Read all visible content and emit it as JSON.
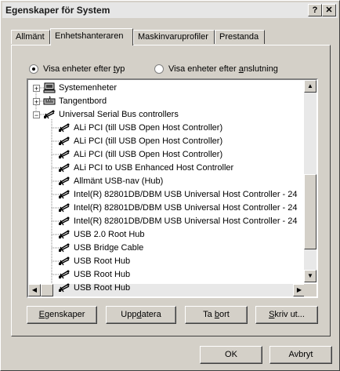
{
  "window": {
    "title": "Egenskaper för System",
    "help_label": "?",
    "close_label": "✕"
  },
  "tabs": [
    {
      "label": "Allmänt"
    },
    {
      "label": "Enhetshanteraren"
    },
    {
      "label": "Maskinvaruprofiler"
    },
    {
      "label": "Prestanda"
    }
  ],
  "view": {
    "by_type": {
      "pre": "Visa enheter efter ",
      "accel": "t",
      "post": "yp"
    },
    "by_connection": {
      "pre": "Visa enheter efter ",
      "accel": "a",
      "post": "nslutning"
    }
  },
  "tree": {
    "items": [
      {
        "label": "Systemenheter",
        "icon": "computer-icon",
        "toggle": "+"
      },
      {
        "label": "Tangentbord",
        "icon": "keyboard-icon",
        "toggle": "+"
      },
      {
        "label": "Universal Serial Bus controllers",
        "icon": "usb-icon",
        "toggle": "−"
      },
      {
        "label": "ALi PCI (till USB Open Host Controller)",
        "icon": "usb-icon"
      },
      {
        "label": "ALi PCI (till USB Open Host Controller)",
        "icon": "usb-icon"
      },
      {
        "label": "ALi PCI (till USB Open Host Controller)",
        "icon": "usb-icon"
      },
      {
        "label": "ALi PCI to USB Enhanced Host Controller",
        "icon": "usb-icon"
      },
      {
        "label": "Allmänt USB-nav (Hub)",
        "icon": "usb-icon"
      },
      {
        "label": "Intel(R) 82801DB/DBM USB Universal Host Controller - 24",
        "icon": "usb-icon"
      },
      {
        "label": "Intel(R) 82801DB/DBM USB Universal Host Controller - 24",
        "icon": "usb-icon"
      },
      {
        "label": "Intel(R) 82801DB/DBM USB Universal Host Controller - 24",
        "icon": "usb-icon"
      },
      {
        "label": "USB 2.0 Root Hub",
        "icon": "usb-icon"
      },
      {
        "label": "USB Bridge Cable",
        "icon": "usb-icon"
      },
      {
        "label": "USB Root Hub",
        "icon": "usb-icon"
      },
      {
        "label": "USB Root Hub",
        "icon": "usb-icon"
      },
      {
        "label": "USB Root Hub",
        "icon": "usb-icon"
      }
    ]
  },
  "actions": {
    "properties": {
      "accel": "E",
      "rest": "genskaper"
    },
    "refresh": {
      "pre": "Upp",
      "accel": "d",
      "post": "atera"
    },
    "remove": {
      "pre": "Ta ",
      "accel": "b",
      "post": "ort"
    },
    "print": {
      "accel": "S",
      "rest": "kriv ut..."
    }
  },
  "dialog": {
    "ok_label": "OK",
    "cancel_label": "Avbryt"
  }
}
